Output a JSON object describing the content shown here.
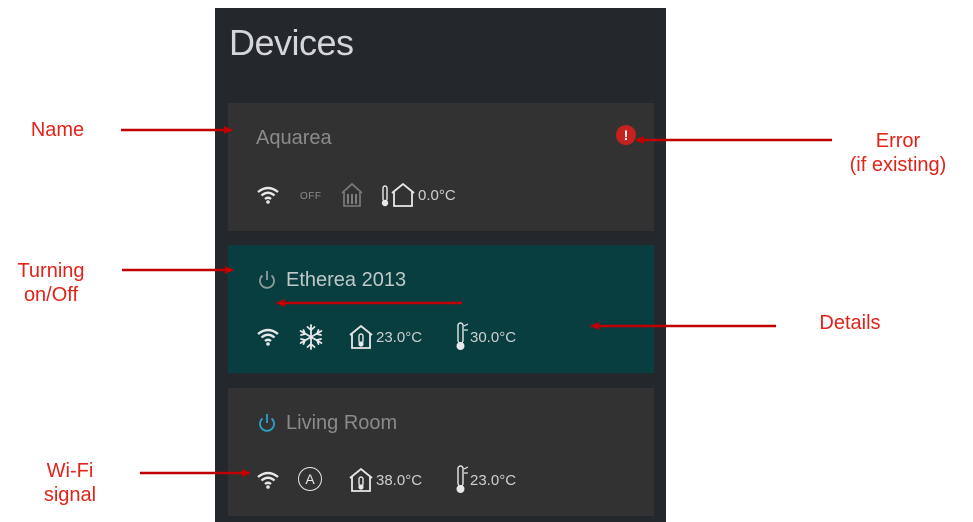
{
  "panel": {
    "title": "Devices"
  },
  "devices": [
    {
      "name": "Aquarea",
      "status": "OFF",
      "temp": "0.0°C",
      "has_error": true,
      "error_symbol": "!"
    },
    {
      "name": "Etherea 2013",
      "indoor_temp": "23.0°C",
      "outdoor_temp": "30.0°C",
      "mode": "snowflake-icon"
    },
    {
      "name": "Living Room",
      "indoor_temp": "38.0°C",
      "outdoor_temp": "23.0°C",
      "mode_letter": "A"
    }
  ],
  "annotations": {
    "name": "Name",
    "error_line1": "Error",
    "error_line2": "(if existing)",
    "power_line1": "Turning",
    "power_line2": "on/Off",
    "details": "Details",
    "wifi_line1": "Wi-Fi",
    "wifi_line2": "signal"
  },
  "colors": {
    "panel_bg": "#24272b",
    "card_bg": "#323232",
    "active_card_bg": "#083e40",
    "annotation_red": "#e2231a",
    "power_on_blue": "#29a3c8",
    "error_red": "#c3221f"
  }
}
